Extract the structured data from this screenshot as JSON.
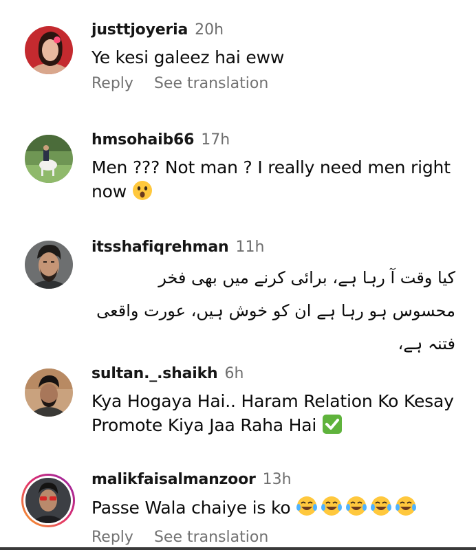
{
  "comments": [
    {
      "username": "justtjoyeria",
      "time": "20h",
      "text": "Ye kesi galeez hai eww",
      "reply": "Reply",
      "translate": "See translation"
    },
    {
      "username": "hmsohaib66",
      "time": "17h",
      "text": "Men ??? Not man ? I really need men right now",
      "emoji": "astonished-face"
    },
    {
      "username": "itsshafiqrehman",
      "time": "11h",
      "text": "کیا وقت آ رہا ہے، برائی کرنے میں بھی فخر محسوس ہو رہا ہے ان کو خوش ہیں، عورت واقعی فتنہ ہے،"
    },
    {
      "username": "sultan._.shaikh",
      "time": "6h",
      "text": "Kya Hogaya Hai.. Haram Relation Ko Kesay Promote Kiya Jaa Raha Hai",
      "emoji": "check-mark-button"
    },
    {
      "username": "malikfaisalmanzoor",
      "time": "13h",
      "text": "Passe Wala chaiye is ko",
      "emoji": "tears-of-joy x5",
      "reply": "Reply",
      "translate": "See translation"
    }
  ],
  "colors": {
    "text": "#0b0b0b",
    "meta": "#6e6e6e",
    "check": "#5fb33c",
    "emoji": "#ffc83d",
    "story_ring": "#e1306c"
  }
}
